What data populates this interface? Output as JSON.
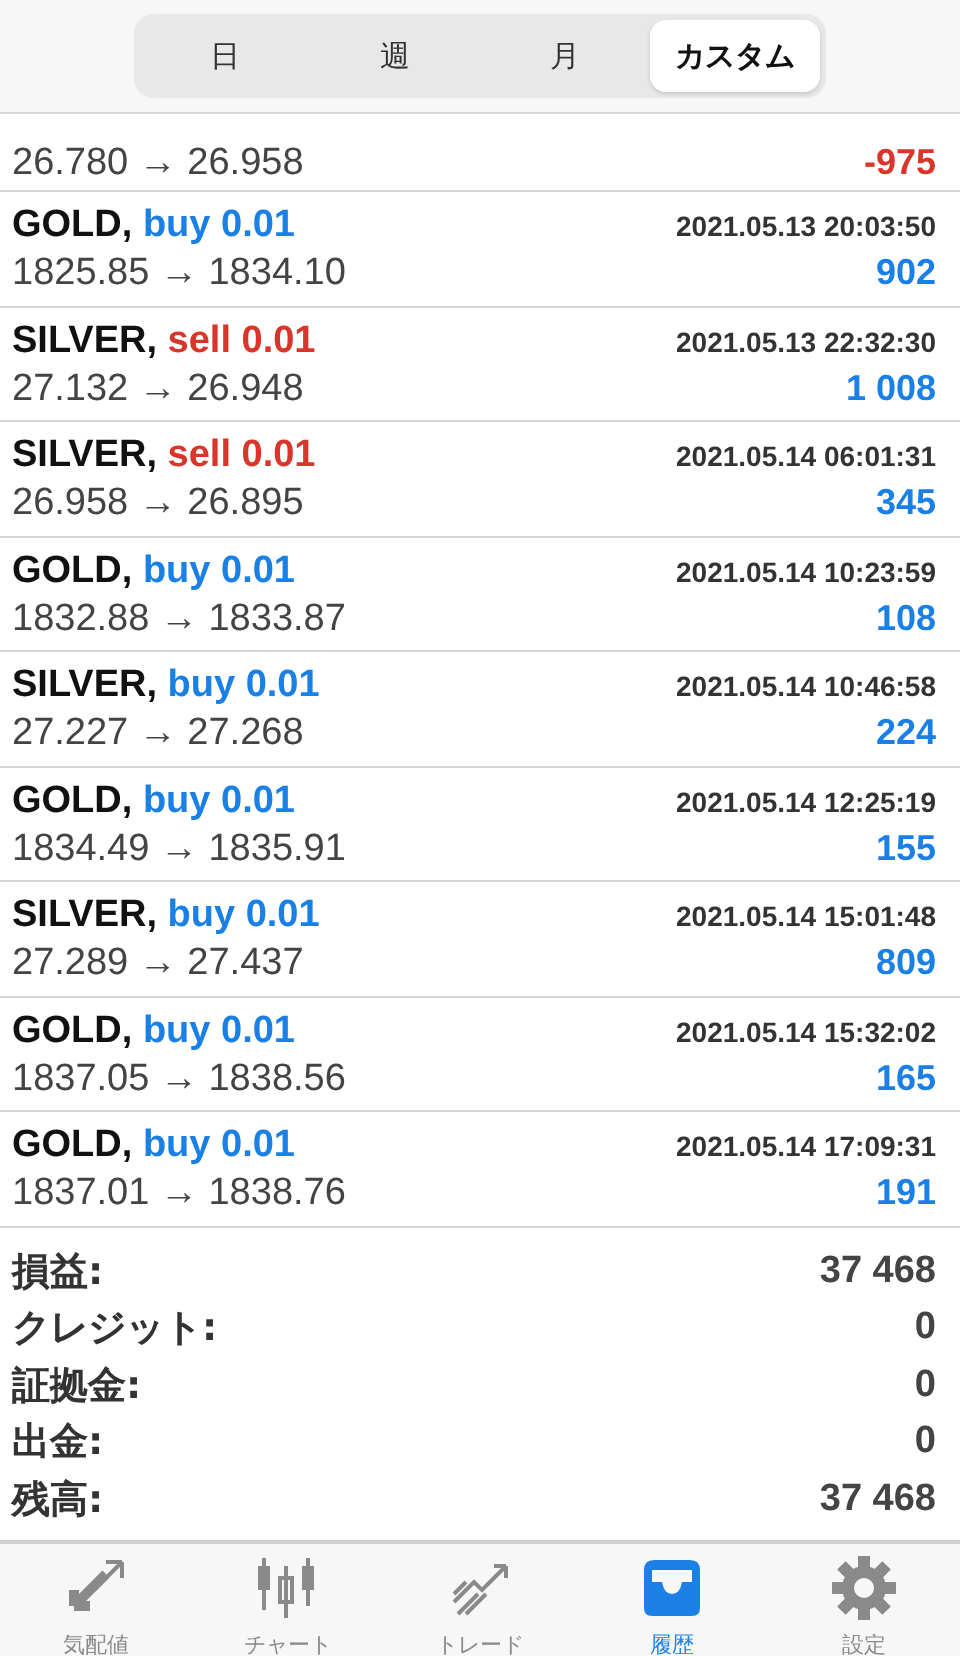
{
  "period_tabs": [
    {
      "label": "日",
      "selected": false
    },
    {
      "label": "週",
      "selected": false
    },
    {
      "label": "月",
      "selected": false
    },
    {
      "label": "カスタム",
      "selected": true
    }
  ],
  "trades": [
    {
      "prices": "26.780 → 26.958",
      "profit": {
        "kind": "loss",
        "text": "-975"
      }
    },
    {
      "symbol": "GOLD,",
      "order": {
        "kind": "buy",
        "text": "buy 0.01"
      },
      "time": "2021.05.13 20:03:50",
      "prices": "1825.85 → 1834.10",
      "profit": {
        "kind": "gain",
        "text": "902"
      }
    },
    {
      "symbol": "SILVER,",
      "order": {
        "kind": "sell",
        "text": "sell 0.01"
      },
      "time": "2021.05.13 22:32:30",
      "prices": "27.132 → 26.948",
      "profit": {
        "kind": "gain",
        "text": "1 008"
      }
    },
    {
      "symbol": "SILVER,",
      "order": {
        "kind": "sell",
        "text": "sell 0.01"
      },
      "time": "2021.05.14 06:01:31",
      "prices": "26.958 → 26.895",
      "profit": {
        "kind": "gain",
        "text": "345"
      }
    },
    {
      "symbol": "GOLD,",
      "order": {
        "kind": "buy",
        "text": "buy 0.01"
      },
      "time": "2021.05.14 10:23:59",
      "prices": "1832.88 → 1833.87",
      "profit": {
        "kind": "gain",
        "text": "108"
      }
    },
    {
      "symbol": "SILVER,",
      "order": {
        "kind": "buy",
        "text": "buy 0.01"
      },
      "time": "2021.05.14 10:46:58",
      "prices": "27.227 → 27.268",
      "profit": {
        "kind": "gain",
        "text": "224"
      }
    },
    {
      "symbol": "GOLD,",
      "order": {
        "kind": "buy",
        "text": "buy 0.01"
      },
      "time": "2021.05.14 12:25:19",
      "prices": "1834.49 → 1835.91",
      "profit": {
        "kind": "gain",
        "text": "155"
      }
    },
    {
      "symbol": "SILVER,",
      "order": {
        "kind": "buy",
        "text": "buy 0.01"
      },
      "time": "2021.05.14 15:01:48",
      "prices": "27.289 → 27.437",
      "profit": {
        "kind": "gain",
        "text": "809"
      }
    },
    {
      "symbol": "GOLD,",
      "order": {
        "kind": "buy",
        "text": "buy 0.01"
      },
      "time": "2021.05.14 15:32:02",
      "prices": "1837.05 → 1838.56",
      "profit": {
        "kind": "gain",
        "text": "165"
      }
    },
    {
      "symbol": "GOLD,",
      "order": {
        "kind": "buy",
        "text": "buy 0.01"
      },
      "time": "2021.05.14 17:09:31",
      "prices": "1837.01 → 1838.76",
      "profit": {
        "kind": "gain",
        "text": "191"
      }
    }
  ],
  "summary": [
    {
      "label": "損益:",
      "value": "37 468"
    },
    {
      "label": "クレジット:",
      "value": "0"
    },
    {
      "label": "証拠金:",
      "value": "0"
    },
    {
      "label": "出金:",
      "value": "0"
    },
    {
      "label": "残高:",
      "value": "37 468"
    }
  ],
  "bottom_tabs": [
    {
      "kind": "quotes",
      "label": "気配値",
      "selected": false
    },
    {
      "kind": "chart",
      "label": "チャート",
      "selected": false
    },
    {
      "kind": "trade",
      "label": "トレード",
      "selected": false
    },
    {
      "kind": "history",
      "label": "履歴",
      "selected": true
    },
    {
      "kind": "settings",
      "label": "設定",
      "selected": false
    }
  ]
}
